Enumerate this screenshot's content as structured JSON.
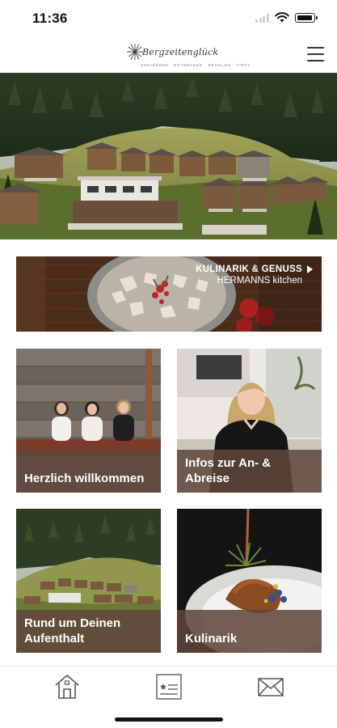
{
  "status_bar": {
    "time": "11:36"
  },
  "header": {
    "logo_text": "Bergzeitenglück",
    "logo_tagline": "GENIESSEN · ENTDECKEN · ERHOLEN · TIROL",
    "logo_icon": "flower-icon",
    "menu_icon": "hamburger-menu-icon"
  },
  "banner": {
    "title": "KULINARIK & GENUSS",
    "subtitle": "HERMANNS kitchen",
    "chevron_icon": "chevron-right-icon"
  },
  "tiles": [
    {
      "label": "Herzlich willkommen"
    },
    {
      "label": "Infos zur An- & Abreise"
    },
    {
      "label": "Rund um Deinen Aufenthalt"
    },
    {
      "label": "Kulinarik"
    }
  ],
  "tabbar": {
    "items": [
      {
        "icon": "house-icon"
      },
      {
        "icon": "guest-card-icon"
      },
      {
        "icon": "envelope-icon"
      }
    ]
  },
  "colors": {
    "tile_caption_bg": "#5f463a",
    "tab_icon": "#555555",
    "background": "#ffffff"
  }
}
